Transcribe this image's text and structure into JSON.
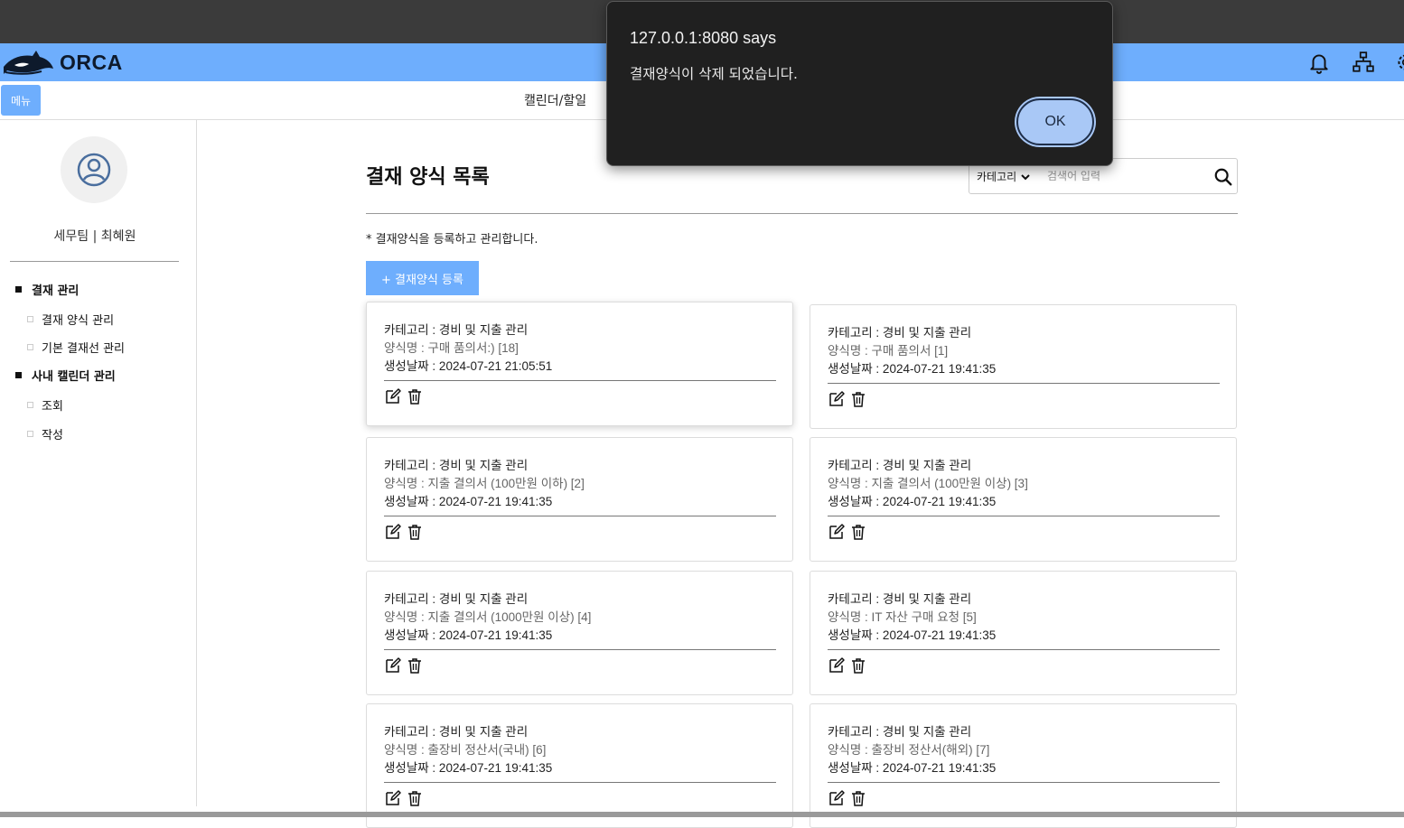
{
  "app": {
    "name": "ORCA"
  },
  "navbar": {
    "icons": [
      "bell-icon",
      "org-chart-icon",
      "gear-icon"
    ]
  },
  "subbar": {
    "menu_label": "메뉴",
    "title": "캘린더/할일"
  },
  "sidebar": {
    "user": "세무팀 | 최혜원",
    "sections": [
      {
        "label": "결재 관리",
        "items": [
          "결재 양식 관리",
          "기본 결재선 관리"
        ]
      },
      {
        "label": "사내 캘린더 관리",
        "items": [
          "조회",
          "작성"
        ]
      }
    ]
  },
  "main": {
    "title": "결재 양식 목록",
    "search": {
      "category": "카테고리",
      "placeholder": "검색어 입력"
    },
    "description": "* 결재양식을 등록하고 관리합니다.",
    "add_button": "+ 결재양식 등록",
    "cards": [
      {
        "category": "카테고리 : 경비 및 지출 관리",
        "name": "양식명 : 구매 품의서:) [18]",
        "date": "생성날짜 : 2024-07-21 21:05:51"
      },
      {
        "category": "카테고리 : 경비 및 지출 관리",
        "name": "양식명 : 구매 품의서 [1]",
        "date": "생성날짜 : 2024-07-21 19:41:35"
      },
      {
        "category": "카테고리 : 경비 및 지출 관리",
        "name": "양식명 : 지출 결의서 (100만원 이하) [2]",
        "date": "생성날짜 : 2024-07-21 19:41:35"
      },
      {
        "category": "카테고리 : 경비 및 지출 관리",
        "name": "양식명 : 지출 결의서 (100만원 이상) [3]",
        "date": "생성날짜 : 2024-07-21 19:41:35"
      },
      {
        "category": "카테고리 : 경비 및 지출 관리",
        "name": "양식명 : 지출 결의서 (1000만원 이상) [4]",
        "date": "생성날짜 : 2024-07-21 19:41:35"
      },
      {
        "category": "카테고리 : 경비 및 지출 관리",
        "name": "양식명 : IT 자산 구매 요청 [5]",
        "date": "생성날짜 : 2024-07-21 19:41:35"
      },
      {
        "category": "카테고리 : 경비 및 지출 관리",
        "name": "양식명 : 출장비 정산서(국내) [6]",
        "date": "생성날짜 : 2024-07-21 19:41:35"
      },
      {
        "category": "카테고리 : 경비 및 지출 관리",
        "name": "양식명 : 출장비 정산서(해외) [7]",
        "date": "생성날짜 : 2024-07-21 19:41:35"
      }
    ]
  },
  "dialog": {
    "title": "127.0.0.1:8080 says",
    "message": "결재양식이 삭제 되었습니다.",
    "ok_label": "OK"
  },
  "colors": {
    "brand": "#6eaefd",
    "dialog_bg": "#202020",
    "ok_button": "#a9c8f6"
  }
}
